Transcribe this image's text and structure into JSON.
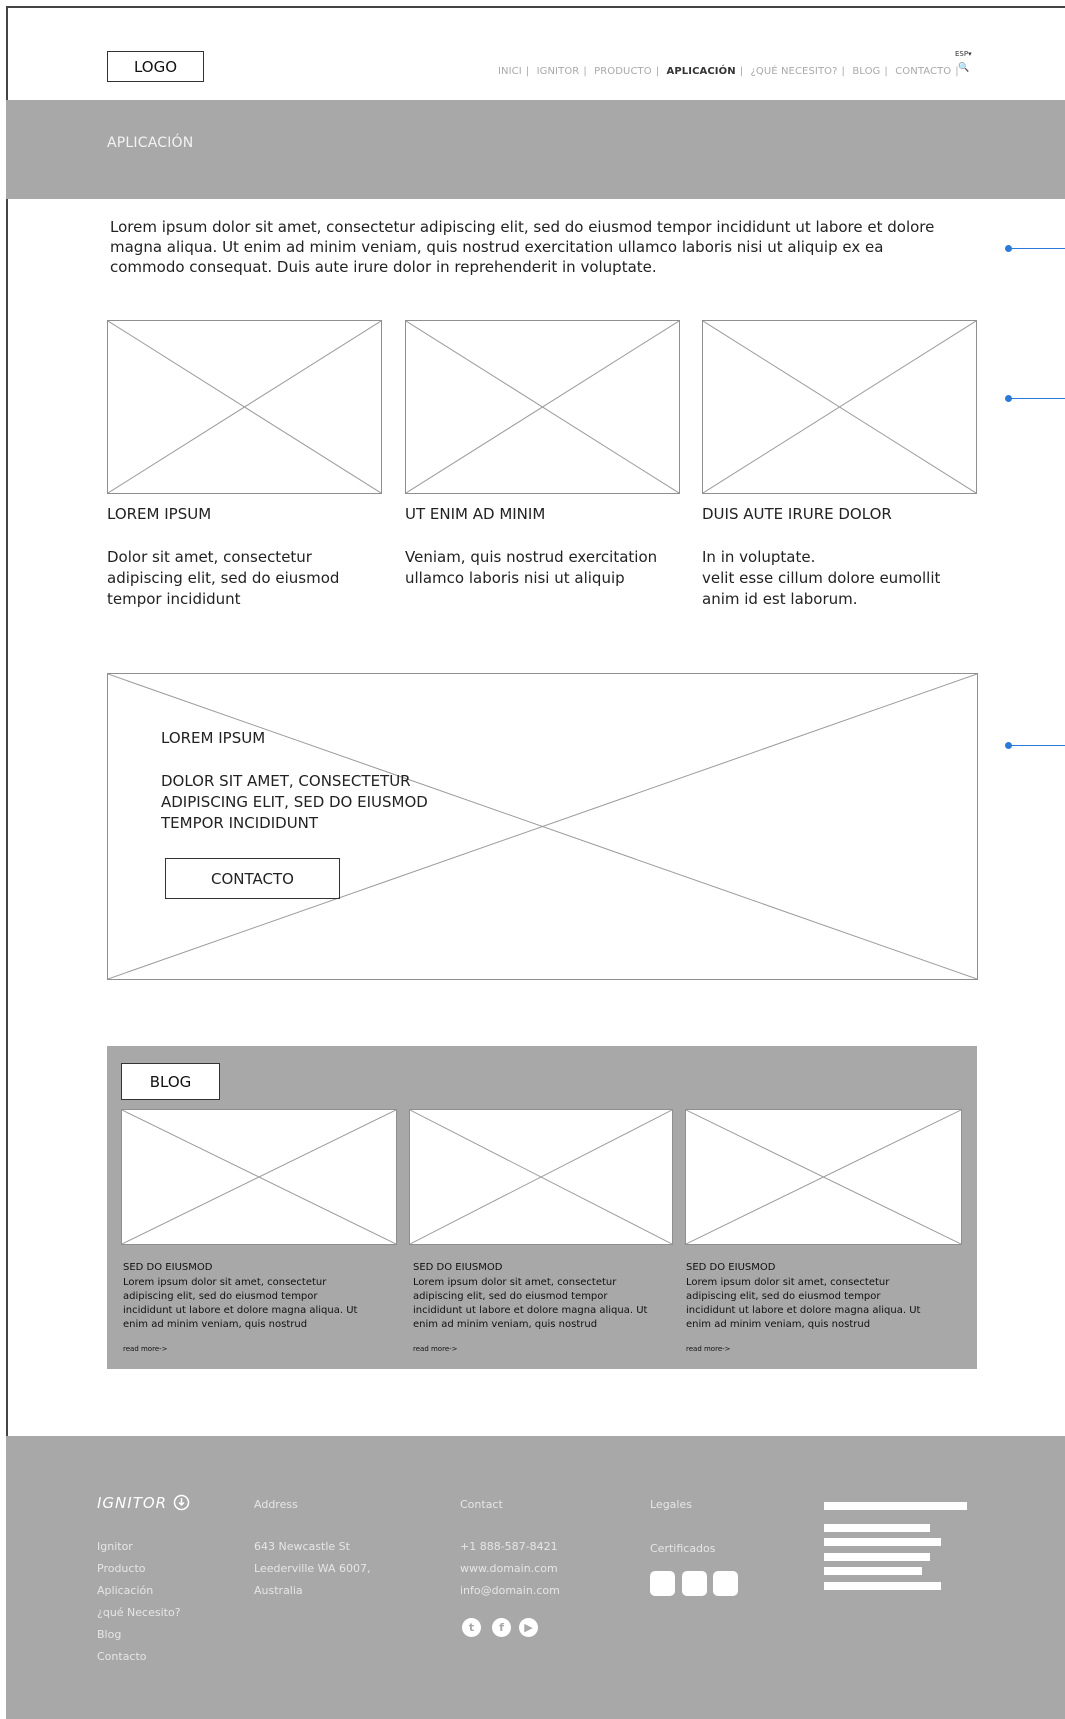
{
  "header": {
    "logo_label": "LOGO",
    "nav": [
      {
        "label": "INICI",
        "active": false
      },
      {
        "label": "IGNITOR",
        "active": false
      },
      {
        "label": "PRODUCTO",
        "active": false
      },
      {
        "label": "APLICACIÓN",
        "active": true
      },
      {
        "label": "¿QUÉ NECESITO?",
        "active": false
      },
      {
        "label": "BLOG",
        "active": false
      },
      {
        "label": "CONTACTO",
        "active": false
      }
    ],
    "language": "ESP▾",
    "search_icon": "🔍"
  },
  "hero": {
    "title": "APLICACIÓN"
  },
  "intro": {
    "text": "Lorem ipsum dolor sit amet, consectetur adipiscing elit, sed do eiusmod tempor incididunt ut labore et dolore magna aliqua. Ut enim ad minim veniam, quis nostrud exercitation ullamco laboris nisi ut aliquip ex ea commodo consequat. Duis aute irure dolor in reprehenderit in voluptate."
  },
  "cards": [
    {
      "title": "LOREM IPSUM",
      "text": "Dolor sit amet, consectetur\nadipiscing elit, sed do eiusmod\ntempor incididunt"
    },
    {
      "title": "UT ENIM AD MINIM",
      "text": "Veniam, quis nostrud exercitation\nullamco laboris nisi ut aliquip"
    },
    {
      "title": "DUIS AUTE IRURE DOLOR",
      "text": "In  in voluptate.\n velit esse cillum dolore eumollit\nanim id est laborum."
    }
  ],
  "banner": {
    "title": "LOREM IPSUM",
    "text": "DOLOR SIT AMET, CONSECTETUR\nADIPISCING ELIT, SED DO EIUSMOD\nTEMPOR INCIDIDUNT",
    "button_label": "CONTACTO"
  },
  "blog": {
    "button_label": "BLOG",
    "posts": [
      {
        "title": "SED DO EIUSMOD",
        "text": "Lorem ipsum dolor sit amet, consectetur\nadipiscing elit, sed do eiusmod tempor\nincididunt ut labore et dolore magna aliqua. Ut\nenim ad minim veniam, quis nostrud",
        "more": "read more->"
      },
      {
        "title": "SED DO EIUSMOD",
        "text": "Lorem ipsum dolor sit amet, consectetur\nadipiscing elit, sed do eiusmod tempor\nincididunt ut labore et dolore magna aliqua. Ut\nenim ad minim veniam, quis nostrud",
        "more": "read more->"
      },
      {
        "title": "SED DO EIUSMOD",
        "text": "Lorem ipsum dolor sit amet, consectetur\nadipiscing elit, sed do eiusmod tempor\nincididunt ut labore et dolore magna aliqua. Ut\nenim ad minim veniam, quis nostrud",
        "more": "read more->"
      }
    ]
  },
  "footer": {
    "brand": "IGNITOR",
    "nav_items": [
      "Ignitor",
      "Producto",
      "Aplicación",
      "¿qué Necesito?",
      "Blog",
      "Contacto"
    ],
    "address_heading": "Address",
    "address_lines": [
      "643 Newcastle St",
      "Leederville WA 6007,",
      "Australia"
    ],
    "contact_heading": "Contact",
    "contact_lines": [
      "+1 888-587-8421",
      "www.domain.com",
      "info@domain.com"
    ],
    "social_icons": [
      "twitter-icon",
      "facebook-icon",
      "youtube-icon"
    ],
    "legal_heading": "Legales",
    "certificates_label": "Certificados"
  },
  "colors": {
    "gray_panel": "#a8a8a8",
    "marker_blue": "#2b7ad8"
  }
}
